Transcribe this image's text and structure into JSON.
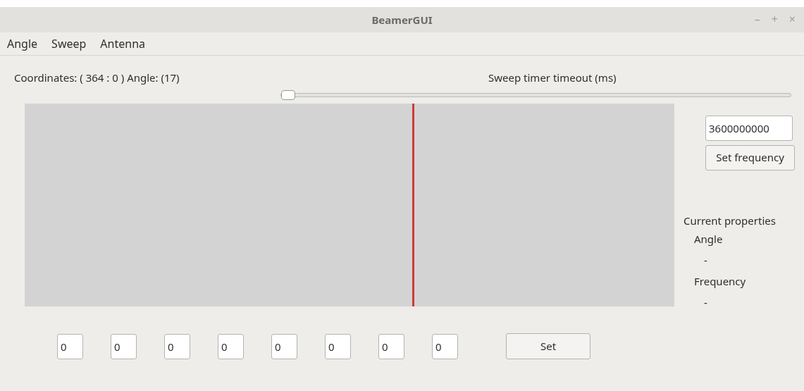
{
  "window": {
    "title": "BeamerGUI",
    "controls": [
      "–",
      "+",
      "×"
    ]
  },
  "menu": [
    "Angle",
    "Sweep",
    "Antenna"
  ],
  "status": "Coordinates: ( 364 : 0 ) Angle: (17)",
  "sweep_slider": {
    "label": "Sweep timer timeout (ms)",
    "level": 0
  },
  "plot": {
    "marker": {
      "level": 0.597
    }
  },
  "frequency_field": {
    "value": "3600000000"
  },
  "set_frequency_button": "Set frequency",
  "properties": {
    "title": "Current properties",
    "items": [
      {
        "label": "Angle",
        "value": "-"
      },
      {
        "label": "Frequency",
        "value": "-"
      }
    ]
  },
  "element_fields": [
    "0",
    "0",
    "0",
    "0",
    "0",
    "0",
    "0",
    "0"
  ],
  "set_button": "Set"
}
